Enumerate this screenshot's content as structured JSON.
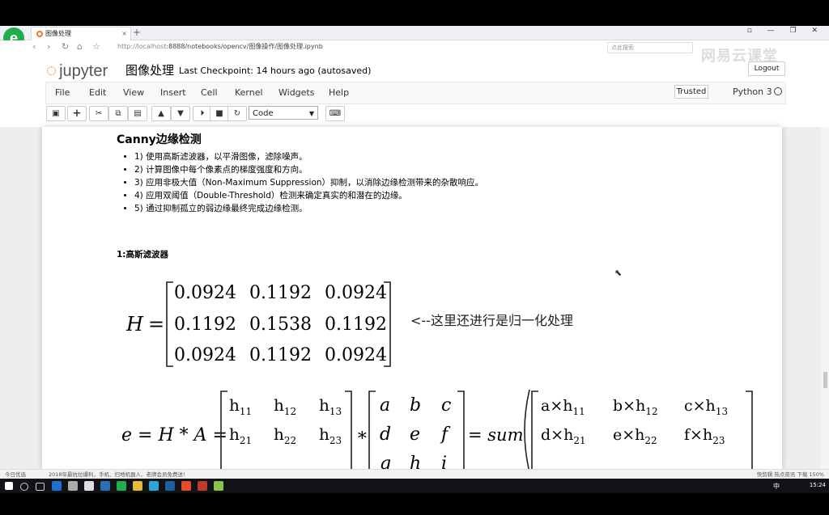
{
  "browser": {
    "tab_title": "图像处理",
    "new_tab": "+",
    "close_tab": "×",
    "url_host": "http://localhost",
    "url_path": ":8888/notebooks/opencv/图像操作/图像处理.ipynb",
    "search_placeholder": "点此搜索",
    "window_controls": "▫ — ❐ ✕"
  },
  "jupyter": {
    "logo_text": "jupyter",
    "notebook_name": "图像处理",
    "checkpoint": "Last Checkpoint: 14 hours ago (autosaved)",
    "logout": "Logout",
    "watermark": "网易云课堂",
    "menu": [
      "File",
      "Edit",
      "View",
      "Insert",
      "Cell",
      "Kernel",
      "Widgets",
      "Help"
    ],
    "trusted": "Trusted",
    "kernel": "Python 3",
    "toolbar_icons": [
      "save-icon",
      "plus-icon",
      "cut-icon",
      "copy-icon",
      "paste-icon",
      "arrow-up-icon",
      "arrow-down-icon",
      "step-icon",
      "stop-icon",
      "restart-icon"
    ],
    "cell_type": "Code"
  },
  "notebook": {
    "heading": "Canny边缘检测",
    "steps": [
      "1) 使用高斯滤波器，以平滑图像，滤除噪声。",
      "2) 计算图像中每个像素点的梯度强度和方向。",
      "3) 应用非极大值（Non-Maximum Suppression）抑制，以消除边缘检测带来的杂散响应。",
      "4) 应用双阈值（Double-Threshold）检测来确定真实的和潜在的边缘。",
      "5) 通过抑制孤立的弱边缘最终完成边缘检测。"
    ],
    "subheading": "1:高斯滤波器",
    "matrix_H": {
      "label": "H",
      "rows": [
        [
          "0.0924",
          "0.1192",
          "0.0924"
        ],
        [
          "0.1192",
          "0.1538",
          "0.1192"
        ],
        [
          "0.0924",
          "0.1192",
          "0.0924"
        ]
      ]
    },
    "annotation": "<--这里还进行是归一化处理",
    "eq_lhs": "e = H * A =",
    "h_rows": [
      [
        "h",
        "11",
        "h",
        "12",
        "h",
        "13"
      ],
      [
        "h",
        "21",
        "h",
        "22",
        "h",
        "23"
      ]
    ],
    "a_rows": [
      [
        "a",
        "b",
        "c"
      ],
      [
        "d",
        "e",
        "f"
      ],
      [
        "g",
        "h",
        "i"
      ]
    ],
    "sum_label": "= sum",
    "prod_rows": [
      [
        "a×h",
        "11",
        "b×h",
        "12",
        "c×h",
        "13"
      ],
      [
        "d×h",
        "21",
        "e×h",
        "22",
        "f×h",
        "23"
      ]
    ]
  },
  "status": {
    "left_text": "今日优选",
    "news": "2018年最抗拉爆利，手机、扫地机器人、老牌会员免费送!",
    "right_text": "快剪辑   热点资讯   下载   150%"
  },
  "taskbar": {
    "clock": "15:24",
    "ime": "中"
  }
}
